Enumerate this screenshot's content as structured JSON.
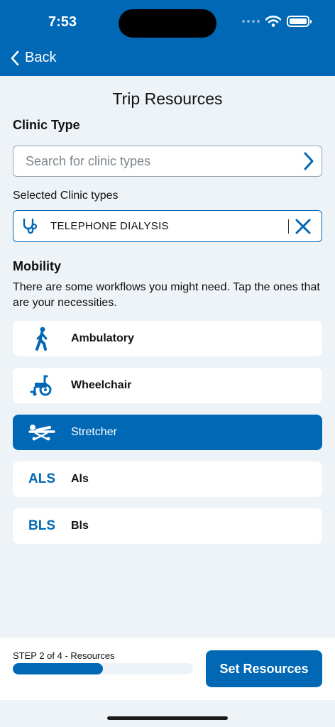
{
  "status_bar": {
    "time": "7:53"
  },
  "nav": {
    "back_label": "Back"
  },
  "page": {
    "title": "Trip Resources"
  },
  "clinic": {
    "section_title": "Clinic Type",
    "search_placeholder": "Search for clinic types",
    "selected_label": "Selected Clinic types",
    "selected": [
      {
        "name": "TELEPHONE DIALYSIS",
        "icon": "stethoscope-icon"
      }
    ]
  },
  "mobility": {
    "section_title": "Mobility",
    "description": "There are some workflows you might need. Tap the ones that are your necessities.",
    "options": [
      {
        "label": "Ambulatory",
        "icon": "walking-person-icon",
        "selected": false
      },
      {
        "label": "Wheelchair",
        "icon": "wheelchair-icon",
        "selected": false
      },
      {
        "label": "Stretcher",
        "icon": "stretcher-icon",
        "selected": true
      },
      {
        "label": "Als",
        "icon_text": "ALS",
        "selected": false
      },
      {
        "label": "Bls",
        "icon_text": "BLS",
        "selected": false
      }
    ]
  },
  "footer": {
    "step_label": "STEP 2 of 4 - Resources",
    "progress": 0.5,
    "button_label": "Set Resources"
  },
  "colors": {
    "primary": "#0068b5",
    "background": "#eef3f8"
  }
}
